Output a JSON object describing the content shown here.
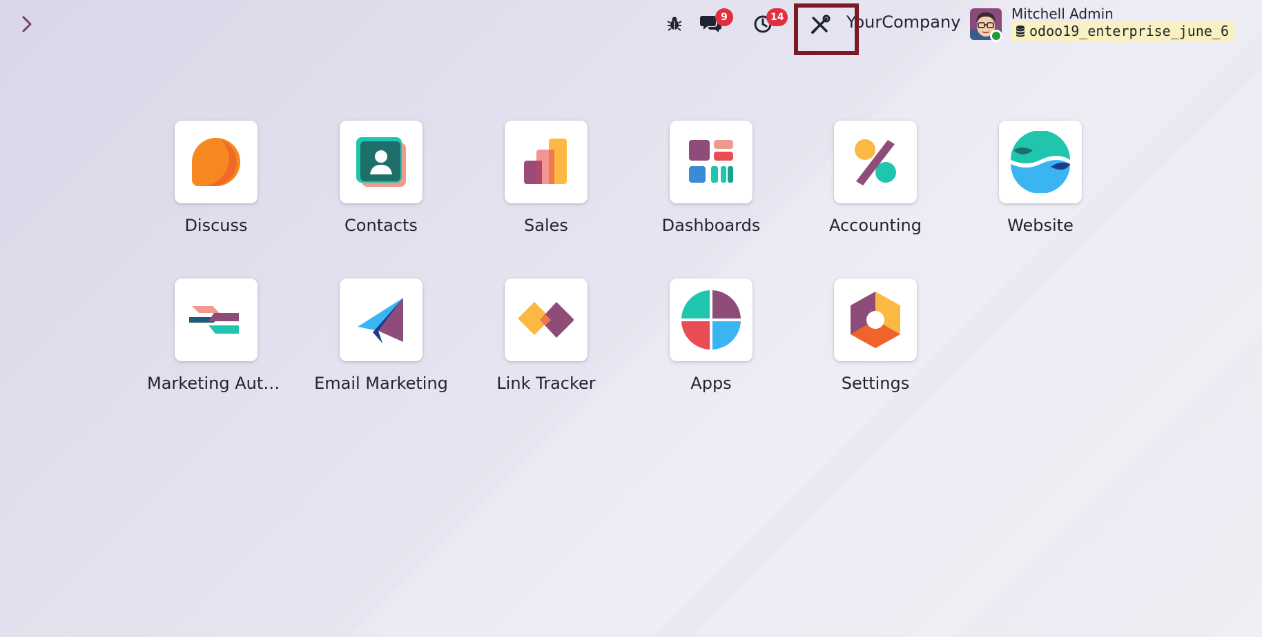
{
  "topbar": {
    "messages_count": "9",
    "activities_count": "14",
    "company": "YourCompany",
    "user_name": "Mitchell Admin",
    "db_name": "odoo19_enterprise_june_6"
  },
  "apps": [
    {
      "label": "Discuss"
    },
    {
      "label": "Contacts"
    },
    {
      "label": "Sales"
    },
    {
      "label": "Dashboards"
    },
    {
      "label": "Accounting"
    },
    {
      "label": "Website"
    },
    {
      "label": "Marketing Auto..."
    },
    {
      "label": "Email Marketing"
    },
    {
      "label": "Link Tracker"
    },
    {
      "label": "Apps"
    },
    {
      "label": "Settings"
    }
  ]
}
